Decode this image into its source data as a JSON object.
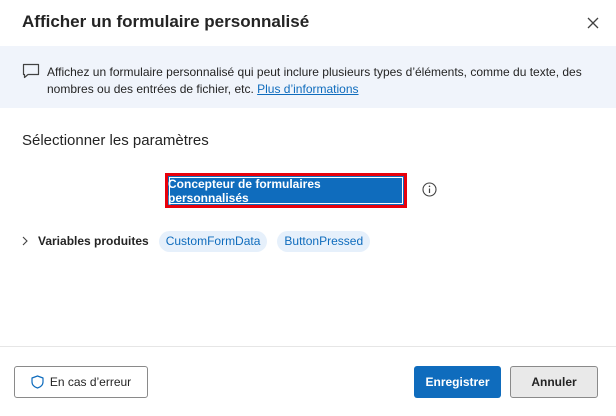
{
  "dialog": {
    "title": "Afficher un formulaire personnalisé",
    "close_icon": "close-icon"
  },
  "info": {
    "icon": "message-icon",
    "text": "Affichez un formulaire personnalisé qui peut inclure plusieurs types d’éléments, comme du texte, des nombres ou des entrées de fichier, etc. ",
    "link": "Plus d’informations"
  },
  "parameters": {
    "section_title": "Sélectionner les paramètres",
    "designer_button": "Concepteur de formulaires personnalisés",
    "help_icon": "info-icon"
  },
  "variables": {
    "label": "Variables produites",
    "chips": [
      "CustomFormData",
      "ButtonPressed"
    ]
  },
  "footer": {
    "error_button": "En cas d’erreur",
    "save_button": "Enregistrer",
    "cancel_button": "Annuler"
  },
  "colors": {
    "accent": "#0f6cbd",
    "highlight": "#e8000b",
    "banner": "#f0f4fb"
  }
}
